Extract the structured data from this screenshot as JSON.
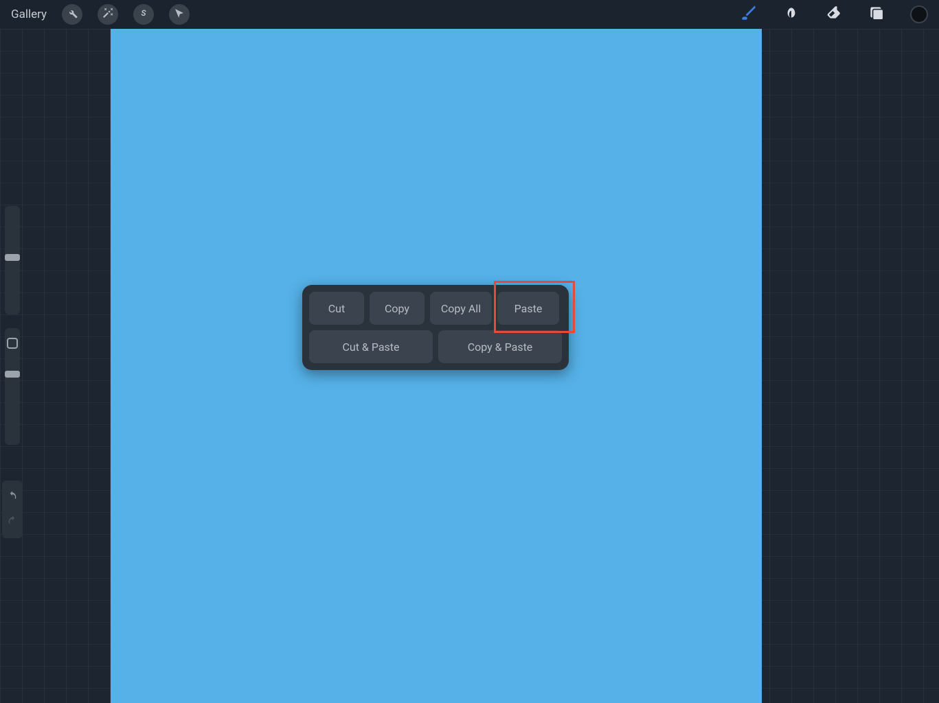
{
  "toolbar": {
    "gallery_label": "Gallery"
  },
  "popup": {
    "cut": "Cut",
    "copy": "Copy",
    "copy_all": "Copy All",
    "paste": "Paste",
    "cut_paste": "Cut & Paste",
    "copy_paste": "Copy & Paste"
  }
}
